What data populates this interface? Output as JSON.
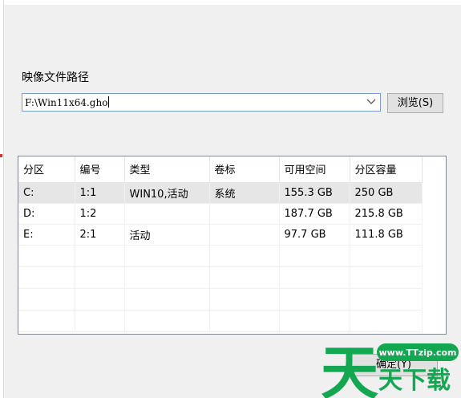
{
  "image_path": {
    "label": "映像文件路径",
    "value": "F:\\Win11x64.gho",
    "dropdown_icon": "chevron-down-icon",
    "browse_label": "浏览(S)"
  },
  "partition_table": {
    "columns": [
      "分区",
      "编号",
      "类型",
      "卷标",
      "可用空间",
      "分区容量"
    ],
    "rows": [
      {
        "partition": "C:",
        "number": "1:1",
        "type": "WIN10,活动",
        "label": "系统",
        "free": "155.3 GB",
        "capacity": "250 GB",
        "selected": true
      },
      {
        "partition": "D:",
        "number": "1:2",
        "type": "",
        "label": "",
        "free": "187.7 GB",
        "capacity": "215.8 GB",
        "selected": false
      },
      {
        "partition": "E:",
        "number": "2:1",
        "type": "活动",
        "label": "",
        "free": "97.7 GB",
        "capacity": "111.8 GB",
        "selected": false
      }
    ]
  },
  "footer": {
    "ok_label": "确定(Y)"
  },
  "watermark": {
    "glyph": "天",
    "site": "www.TTzip.com",
    "text": "天下载",
    "color": "#14a751"
  }
}
